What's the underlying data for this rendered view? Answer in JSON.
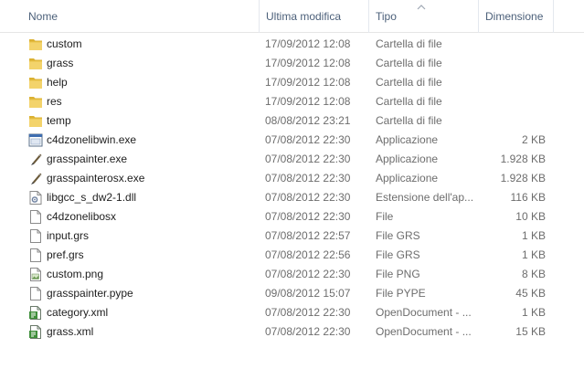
{
  "columns": {
    "name": "Nome",
    "modified": "Ultima modifica",
    "type": "Tipo",
    "size": "Dimensione"
  },
  "colors": {
    "folder": "#e9c34a",
    "header_text": "#4c607a"
  },
  "files": [
    {
      "name": "custom",
      "modified": "17/09/2012 12:08",
      "type": "Cartella di file",
      "size": "",
      "icon": "folder-icon"
    },
    {
      "name": "grass",
      "modified": "17/09/2012 12:08",
      "type": "Cartella di file",
      "size": "",
      "icon": "folder-icon"
    },
    {
      "name": "help",
      "modified": "17/09/2012 12:08",
      "type": "Cartella di file",
      "size": "",
      "icon": "folder-icon"
    },
    {
      "name": "res",
      "modified": "17/09/2012 12:08",
      "type": "Cartella di file",
      "size": "",
      "icon": "folder-icon"
    },
    {
      "name": "temp",
      "modified": "08/08/2012 23:21",
      "type": "Cartella di file",
      "size": "",
      "icon": "folder-icon"
    },
    {
      "name": "c4dzonelibwin.exe",
      "modified": "07/08/2012 22:30",
      "type": "Applicazione",
      "size": "2 KB",
      "icon": "application-icon"
    },
    {
      "name": "grasspainter.exe",
      "modified": "07/08/2012 22:30",
      "type": "Applicazione",
      "size": "1.928 KB",
      "icon": "brush-icon"
    },
    {
      "name": "grasspainterosx.exe",
      "modified": "07/08/2012 22:30",
      "type": "Applicazione",
      "size": "1.928 KB",
      "icon": "brush-icon"
    },
    {
      "name": "libgcc_s_dw2-1.dll",
      "modified": "07/08/2012 22:30",
      "type": "Estensione dell'ap...",
      "size": "116 KB",
      "icon": "dll-icon"
    },
    {
      "name": "c4dzonelibosx",
      "modified": "07/08/2012 22:30",
      "type": "File",
      "size": "10 KB",
      "icon": "file-icon"
    },
    {
      "name": "input.grs",
      "modified": "07/08/2012 22:57",
      "type": "File GRS",
      "size": "1 KB",
      "icon": "file-icon"
    },
    {
      "name": "pref.grs",
      "modified": "07/08/2012 22:56",
      "type": "File GRS",
      "size": "1 KB",
      "icon": "file-icon"
    },
    {
      "name": "custom.png",
      "modified": "07/08/2012 22:30",
      "type": "File PNG",
      "size": "8 KB",
      "icon": "image-file-icon"
    },
    {
      "name": "grasspainter.pype",
      "modified": "09/08/2012 15:07",
      "type": "File PYPE",
      "size": "45 KB",
      "icon": "file-icon"
    },
    {
      "name": "category.xml",
      "modified": "07/08/2012 22:30",
      "type": "OpenDocument - ...",
      "size": "1 KB",
      "icon": "xml-document-icon"
    },
    {
      "name": "grass.xml",
      "modified": "07/08/2012 22:30",
      "type": "OpenDocument - ...",
      "size": "15 KB",
      "icon": "xml-document-icon"
    }
  ]
}
